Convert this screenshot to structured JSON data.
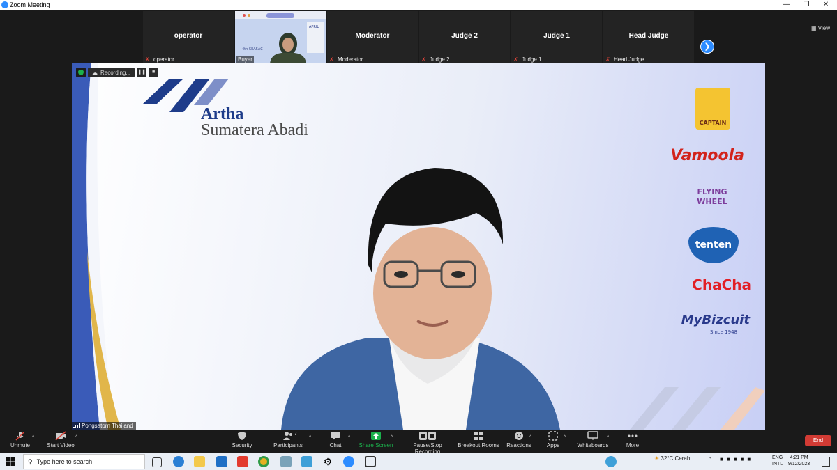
{
  "window": {
    "title": "Zoom Meeting"
  },
  "participants": [
    {
      "name": "operator",
      "label": "operator",
      "video": false
    },
    {
      "name": "",
      "label": "Buyer",
      "video": true
    },
    {
      "name": "Moderator",
      "label": "Moderator",
      "video": false
    },
    {
      "name": "Judge 2",
      "label": "Judge 2",
      "video": false
    },
    {
      "name": "Judge 1",
      "label": "Judge 1",
      "video": false
    },
    {
      "name": "Head Judge",
      "label": "Head Judge",
      "video": false
    }
  ],
  "view_label": "View",
  "recording": {
    "label": "Recording..."
  },
  "speaker": {
    "name": "Pongsatorn Thailand"
  },
  "backdrop": {
    "company_line1": "Artha",
    "company_line2": "Sumatera Abadi",
    "brands": [
      "CAPTAIN",
      "Vamoola",
      "FLYING WHEEL",
      "tenten",
      "ChaCha",
      "MyBizcuit"
    ],
    "brand_subtext": "Since 1948"
  },
  "toolbar": {
    "unmute": "Unmute",
    "start_video": "Start Video",
    "security": "Security",
    "participants": "Participants",
    "participants_count": "7",
    "chat": "Chat",
    "share_screen": "Share Screen",
    "recording": "Pause/Stop Recording",
    "breakout": "Breakout Rooms",
    "reactions": "Reactions",
    "apps": "Apps",
    "whiteboards": "Whiteboards",
    "more": "More",
    "end": "End"
  },
  "taskbar": {
    "search_placeholder": "Type here to search",
    "weather": "32°C  Cerah",
    "lang1": "ENG",
    "lang2": "INTL",
    "time": "4:21 PM",
    "date": "9/12/2023"
  },
  "colors": {
    "accent": "#2d8cff",
    "end": "#d23b34",
    "share": "#1bb14c"
  }
}
